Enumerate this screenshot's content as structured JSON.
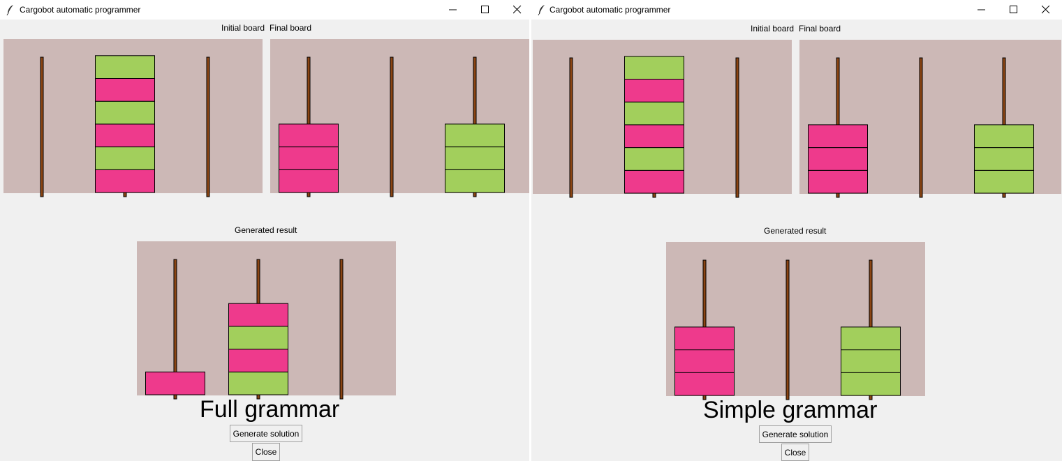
{
  "colors": {
    "board_bg": "#ccb8b6",
    "pink": "#ee3a8c",
    "green": "#a2cf5c",
    "pole": "#8b4513"
  },
  "windows": [
    {
      "title": "Cargobot automatic programmer",
      "initial_label": "Initial board",
      "final_label": "Final board",
      "generated_label": "Generated result",
      "grammar_title": "Full grammar",
      "generate_button": "Generate solution",
      "close_button": "Close",
      "boards": {
        "initial": [
          [],
          [
            "pink",
            "green",
            "pink",
            "green",
            "pink",
            "green"
          ],
          []
        ],
        "final": [
          [
            "pink",
            "pink",
            "pink"
          ],
          [],
          [
            "green",
            "green",
            "green"
          ]
        ],
        "result": [
          [
            "pink"
          ],
          [
            "green",
            "pink",
            "green",
            "pink"
          ],
          []
        ]
      }
    },
    {
      "title": "Cargobot automatic programmer",
      "initial_label": "Initial board",
      "final_label": "Final board",
      "generated_label": "Generated result",
      "grammar_title": "Simple grammar",
      "generate_button": "Generate solution",
      "close_button": "Close",
      "boards": {
        "initial": [
          [],
          [
            "pink",
            "green",
            "pink",
            "green",
            "pink",
            "green"
          ],
          []
        ],
        "final": [
          [
            "pink",
            "pink",
            "pink"
          ],
          [],
          [
            "green",
            "green",
            "green"
          ]
        ],
        "result": [
          [
            "pink",
            "pink",
            "pink"
          ],
          [],
          [
            "green",
            "green",
            "green"
          ]
        ]
      }
    }
  ]
}
